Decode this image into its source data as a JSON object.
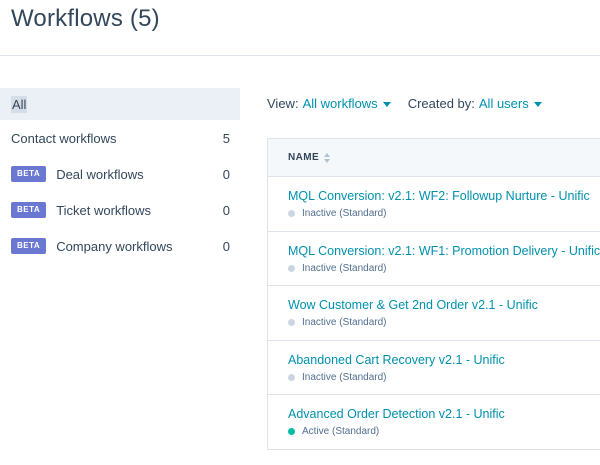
{
  "header": {
    "title": "Workflows (5)"
  },
  "sidebar": {
    "all_label": "All",
    "items": [
      {
        "label": "Contact workflows",
        "count": "5",
        "beta": false
      },
      {
        "label": "Deal workflows",
        "count": "0",
        "beta": true
      },
      {
        "label": "Ticket workflows",
        "count": "0",
        "beta": true
      },
      {
        "label": "Company workflows",
        "count": "0",
        "beta": true
      }
    ],
    "beta_label": "BETA"
  },
  "filters": {
    "view_label": "View:",
    "view_value": "All workflows",
    "created_label": "Created by:",
    "created_value": "All users"
  },
  "table": {
    "column_name": "NAME",
    "rows": [
      {
        "name": "MQL Conversion: v2.1: WF2: Followup Nurture - Unific",
        "status": "Inactive (Standard)",
        "active": false
      },
      {
        "name": "MQL Conversion: v2.1: WF1: Promotion Delivery - Unific",
        "status": "Inactive (Standard)",
        "active": false
      },
      {
        "name": "Wow Customer & Get 2nd Order v2.1 - Unific",
        "status": "Inactive (Standard)",
        "active": false
      },
      {
        "name": "Abandoned Cart Recovery v2.1 - Unific",
        "status": "Inactive (Standard)",
        "active": false
      },
      {
        "name": "Advanced Order Detection v2.1 - Unific",
        "status": "Active (Standard)",
        "active": true
      }
    ]
  },
  "colors": {
    "link": "#0091ae",
    "text": "#33475b",
    "beta": "#6a78d1",
    "active_dot": "#00bda5",
    "inactive_dot": "#cbd6e2"
  }
}
